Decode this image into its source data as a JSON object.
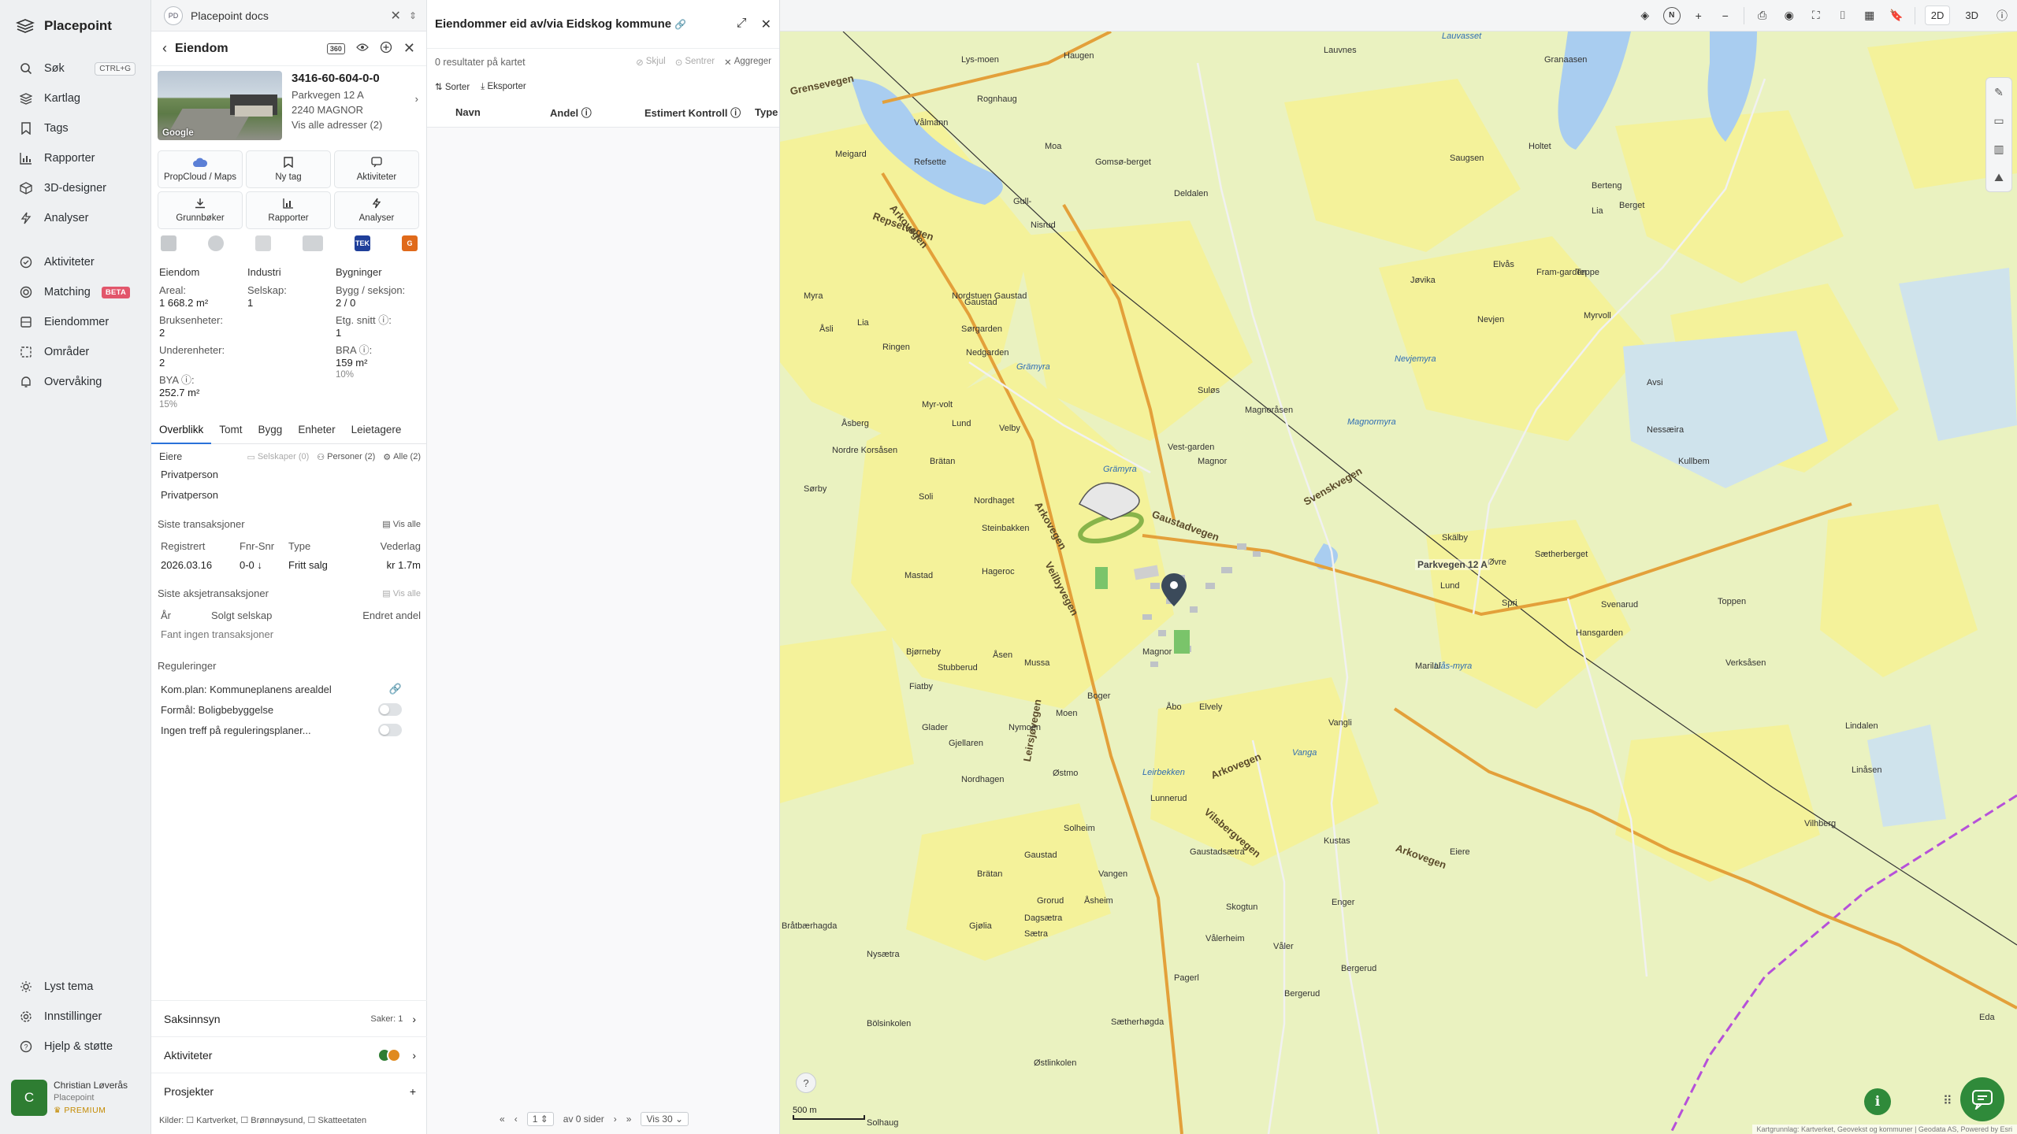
{
  "app": {
    "name": "Placepoint"
  },
  "sidebar": {
    "top": [
      {
        "label": "Søk",
        "icon": "search-icon",
        "shortcut": "CTRL+G"
      },
      {
        "label": "Kartlag",
        "icon": "layers-icon"
      },
      {
        "label": "Tags",
        "icon": "bookmark-icon"
      },
      {
        "label": "Rapporter",
        "icon": "chart-icon"
      },
      {
        "label": "3D-designer",
        "icon": "cube-icon"
      },
      {
        "label": "Analyser",
        "icon": "bolt-icon"
      }
    ],
    "middle": [
      {
        "label": "Aktiviteter",
        "icon": "activity-icon"
      },
      {
        "label": "Matching",
        "icon": "target-icon",
        "badge": "BETA"
      },
      {
        "label": "Eiendommer",
        "icon": "building-icon"
      },
      {
        "label": "Områder",
        "icon": "area-icon"
      },
      {
        "label": "Overvåking",
        "icon": "bell-icon"
      }
    ],
    "bottom": [
      {
        "label": "Lyst tema",
        "icon": "sun-icon"
      },
      {
        "label": "Innstillinger",
        "icon": "gear-icon"
      },
      {
        "label": "Hjelp & støtte",
        "icon": "help-icon"
      }
    ],
    "user": {
      "initial": "C",
      "name": "Christian Løverås",
      "org": "Placepoint",
      "plan": "PREMIUM"
    }
  },
  "docs": {
    "badge": "PD",
    "title": "Placepoint docs"
  },
  "property": {
    "header": "Eiendom",
    "id": "3416-60-604-0-0",
    "address": "Parkvegen 12 A",
    "postal": "2240 MAGNOR",
    "all_addresses": "Vis alle adresser (2)",
    "streetview_brand": "Google",
    "actions": [
      {
        "label": "PropCloud / Maps",
        "icon": "cloud-icon"
      },
      {
        "label": "Ny tag",
        "icon": "bookmark-icon"
      },
      {
        "label": "Aktiviteter",
        "icon": "activity-icon"
      },
      {
        "label": "Grunnbøker",
        "icon": "download-icon"
      },
      {
        "label": "Rapporter",
        "icon": "chart-icon"
      },
      {
        "label": "Analyser",
        "icon": "bolt-icon"
      }
    ],
    "logo_tek": "TEK",
    "logo_g": "G",
    "stats": {
      "col1_head": "Eiendom",
      "areal_label": "Areal:",
      "areal_value": "1 668.2 m²",
      "bruks_label": "Bruksenheter:",
      "bruks_value": "2",
      "under_label": "Underenheter:",
      "under_value": "2",
      "bya_label": "BYA ⓘ:",
      "bya_value": "252.7 m²",
      "bya_pct": "15%",
      "col2_head": "Industri",
      "selskap_label": "Selskap:",
      "selskap_value": "1",
      "col3_head": "Bygninger",
      "bygg_label": "Bygg / seksjon:",
      "bygg_value": "2 / 0",
      "etg_label": "Etg. snitt ⓘ:",
      "etg_value": "1",
      "bra_label": "BRA ⓘ:",
      "bra_value": "159 m²",
      "bra_pct": "10%"
    },
    "tabs": [
      "Overblikk",
      "Tomt",
      "Bygg",
      "Enheter",
      "Leietagere"
    ],
    "owners": {
      "label": "Eiere",
      "chip_companies": "Selskaper (0)",
      "chip_persons": "Personer (2)",
      "chip_all": "Alle (2)",
      "rows": [
        "Privatperson",
        "Privatperson"
      ]
    },
    "transactions": {
      "label": "Siste transaksjoner",
      "show_all": "Vis alle",
      "columns": [
        "Registrert",
        "Fnr-Snr",
        "Type",
        "Vederlag"
      ],
      "row": [
        "2026.03.16",
        "0-0 ↓",
        "Fritt salg",
        "kr 1.7m"
      ]
    },
    "share_transactions": {
      "label": "Siste aksjetransaksjoner",
      "show_all": "Vis alle",
      "columns": [
        "År",
        "Solgt selskap",
        "Endret andel"
      ],
      "empty": "Fant ingen transaksjoner"
    },
    "regulations": {
      "label": "Reguleringer",
      "rows": [
        "Kom.plan: Kommuneplanens arealdel",
        "Formål: Boligbebyggelse",
        "Ingen treff på reguleringsplaner..."
      ]
    },
    "saksinnsyn": {
      "label": "Saksinnsyn",
      "meta": "Saker: 1"
    },
    "aktiviteter": {
      "label": "Aktiviteter"
    },
    "prosjekter": {
      "label": "Prosjekter"
    },
    "sources": "Kilder: ☐ Kartverket, ☐ Brønnøysund, ☐ Skatteetaten"
  },
  "results": {
    "title": "Eiendommer eid av/via Eidskog kommune",
    "count": "0 resultater på kartet",
    "hide": "Skjul",
    "center": "Sentrer",
    "aggregate": "Aggreger",
    "sort": "Sorter",
    "export": "Eksporter",
    "columns": [
      "Navn",
      "Andel ⓘ",
      "Estimert Kontroll ⓘ",
      "Type"
    ],
    "pager": {
      "page": "1",
      "of_pages": "av 0 sider",
      "per_page": "Vis 30"
    }
  },
  "map": {
    "modes": [
      "2D",
      "3D"
    ],
    "active_mode": "2D",
    "scale": "500 m",
    "attribution": "Kartgrunnlag: Kartverket, Geovekst og kommuner | Geodata AS, Powered by Esri",
    "marker": "Parkvegen 12 A",
    "labels": {
      "roads": [
        "Grensevegen",
        "Arkovegen",
        "Repsetvegen",
        "Arkovegen",
        "Veilbyvegen",
        "Gaustadvegen",
        "Svenskvegen",
        "Arkovegen",
        "Vilsbergvegen",
        "Arkovegen",
        "Leirsjøvegen"
      ],
      "water": [
        "Grämyra",
        "Grämyra",
        "Nevjemyra",
        "Magnormyra",
        "Lauvasset",
        "Vanga",
        "Leirbekken",
        "Liås-myra"
      ],
      "places": [
        "Lys-moen",
        "Haugen",
        "Lauvnes",
        "Granaasen",
        "Vålmann",
        "Rognhaug",
        "Moa",
        "Meigard",
        "Refsette",
        "Gull-",
        "Nisrud",
        "Gomsø-berget",
        "Deldalen",
        "Saugsen",
        "Holtet",
        "Berteng",
        "Berget",
        "Lia",
        "Elvås",
        "Teppe",
        "Myrvoll",
        "Fram-garden",
        "Jøvika",
        "Nevjen",
        "Avsi",
        "Myra",
        "Gaustad",
        "Nordstuen Gaustad",
        "Sørgarden",
        "Nedgarden",
        "Lia",
        "Åsli",
        "Ringen",
        "Myr-volt",
        "Lund",
        "Suløs",
        "Magnoråsen",
        "Nessæira",
        "Kullbem",
        "Åsberg",
        "Nordre Korsåsen",
        "Brätan",
        "Velby",
        "Vest-garden",
        "Magnor",
        "Sørby",
        "Soli",
        "Nordhaget",
        "Steinbakken",
        "Skälby",
        "Sætherberget",
        "Hageroc",
        "Mastad",
        "Øvre",
        "Spri",
        "Lund",
        "Svenarud",
        "Toppen",
        "Bjørneby",
        "Åsen",
        "Mussa",
        "Stubberud",
        "Magnor",
        "Hansgarden",
        "Verksåsen",
        "Fiatby",
        "Boger",
        "Åbo",
        "Elvely",
        "Marilal",
        "Glader",
        "Moen",
        "Nymoen",
        "Vangli",
        "Lindalen",
        "Gjellaren",
        "Østmo",
        "Nordhagen",
        "Lunnerud",
        "Linåsen",
        "Solheim",
        "Gaustadsætra",
        "Kustas",
        "Eiere",
        "Gaustad",
        "Brätan",
        "Vangen",
        "Grorud",
        "Åsheim",
        "Skogtun",
        "Dagsætra",
        "Sætra",
        "Enger",
        "Bråtbærhagda",
        "Gjølia",
        "Nysætra",
        "Vålerheim",
        "Våler",
        "Bergerud",
        "Bölsinkolen",
        "Vilhberg",
        "Pagerl",
        "Sætherhøgda",
        "Østlinkolen",
        "Solhaug",
        "Bergerud",
        "Eda"
      ]
    }
  }
}
